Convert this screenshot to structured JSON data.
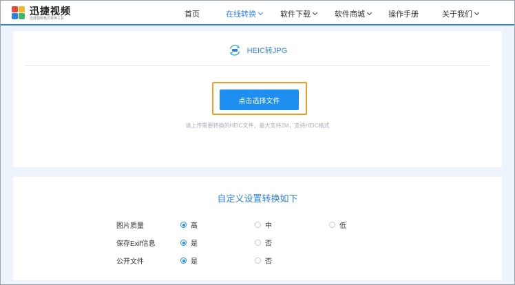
{
  "header": {
    "logo_title": "迅捷视频",
    "logo_subtitle": "迅捷视频格式转换工具",
    "nav": [
      {
        "label": "首页",
        "has_dropdown": false,
        "active": false
      },
      {
        "label": "在线转换",
        "has_dropdown": true,
        "active": true
      },
      {
        "label": "软件下载",
        "has_dropdown": true,
        "active": false
      },
      {
        "label": "软件商城",
        "has_dropdown": true,
        "active": false
      },
      {
        "label": "操作手册",
        "has_dropdown": false,
        "active": false
      },
      {
        "label": "关于我们",
        "has_dropdown": true,
        "active": false
      }
    ]
  },
  "upload": {
    "title": "HEIC转JPG",
    "button_label": "点击选择文件",
    "hint": "请上传需要转换的HEIC文件，最大支持2M，支持HEIC格式"
  },
  "settings": {
    "title": "自定义设置转换如下",
    "rows": [
      {
        "label": "图片质量",
        "options": [
          "高",
          "中",
          "低"
        ],
        "selected": 0
      },
      {
        "label": "保存Exif信息",
        "options": [
          "是",
          "否"
        ],
        "selected": 0
      },
      {
        "label": "公开文件",
        "options": [
          "是",
          "否"
        ],
        "selected": 0
      }
    ]
  },
  "colors": {
    "accent": "#2f7fe6",
    "button": "#1f8ef1",
    "highlight": "#f39c21",
    "background": "#eef4fb"
  }
}
